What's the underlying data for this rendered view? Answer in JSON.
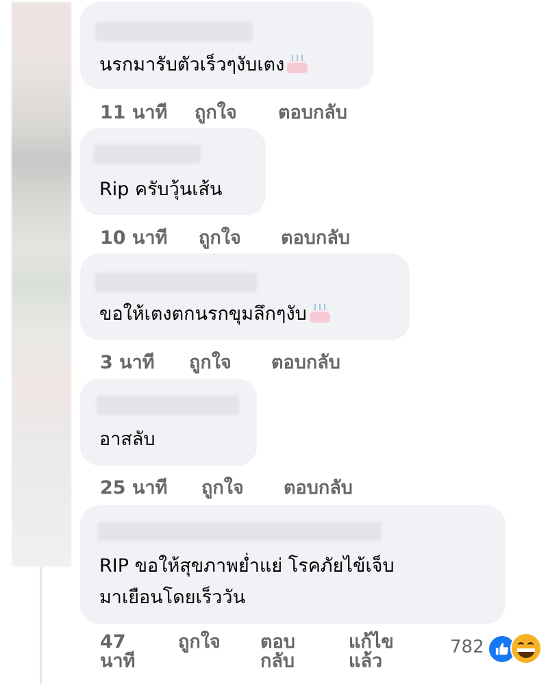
{
  "comments": [
    {
      "text": "นรกมารับตัวเร็วๆงับเตง",
      "has_cake_emoji": true,
      "time": "11 นาที",
      "like_label": "ถูกใจ",
      "reply_label": "ตอบกลับ"
    },
    {
      "text": "Rip ครับวุ้นเส้น",
      "has_cake_emoji": false,
      "time": "10 นาที",
      "like_label": "ถูกใจ",
      "reply_label": "ตอบกลับ"
    },
    {
      "text": "ขอให้เตงตกนรกขุมลึกๆงับ",
      "has_cake_emoji": true,
      "time": "3 นาที",
      "like_label": "ถูกใจ",
      "reply_label": "ตอบกลับ"
    },
    {
      "text": "อาสลับ",
      "has_cake_emoji": false,
      "time": "25 นาที",
      "like_label": "ถูกใจ",
      "reply_label": "ตอบกลับ"
    },
    {
      "text_line1": "RIP ขอให้สุขภาพย่ำแย่ โรคภัยไข้เจ็บ",
      "text_line2": "มาเยือนโดยเร็ววัน",
      "time": "47 นาที",
      "like_label": "ถูกใจ",
      "reply_label": "ตอบกลับ",
      "edited_label": "แก้ไขแล้ว",
      "reaction_count": "782",
      "reaction_icons": [
        "like-icon",
        "haha-icon"
      ]
    }
  ],
  "colors": {
    "bubble_bg": "#f0f2f5",
    "meta_text": "#65676b",
    "like_blue": "#1877f2",
    "haha_yellow": "#f7b125"
  }
}
